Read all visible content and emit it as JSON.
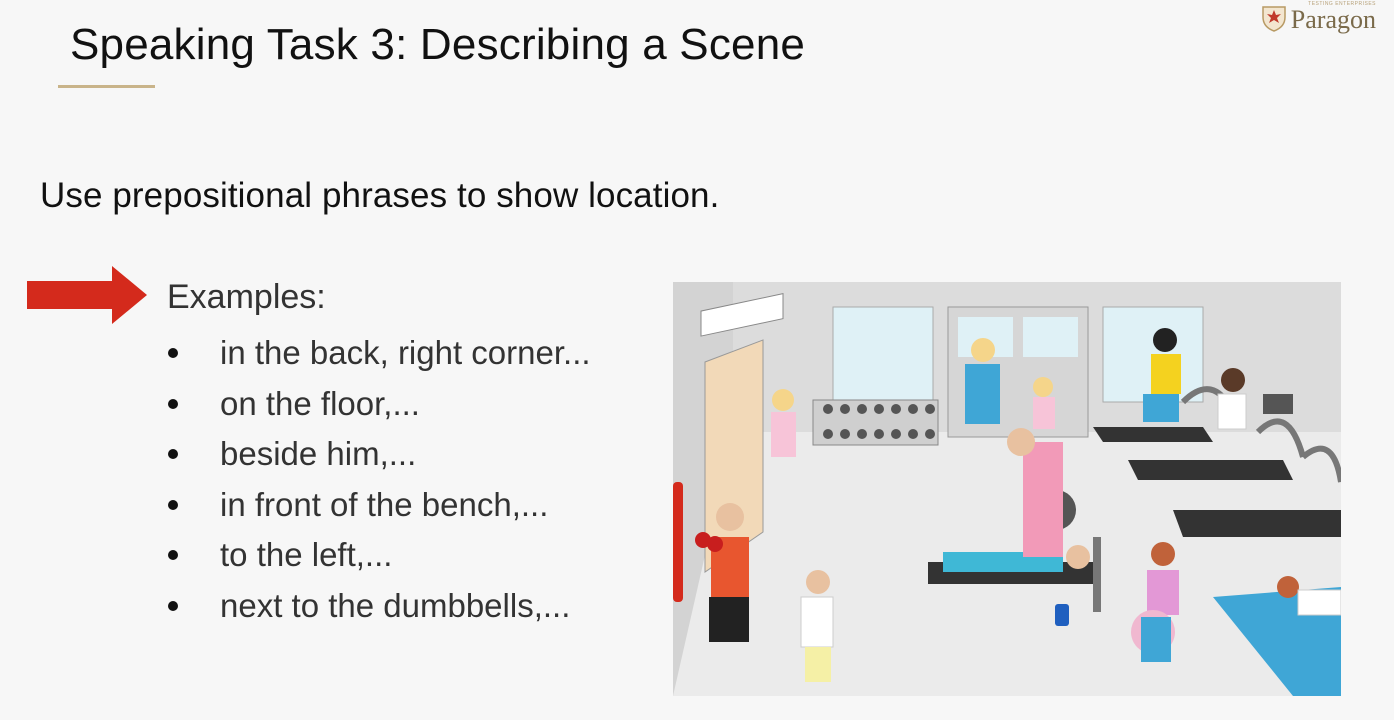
{
  "logo": {
    "text": "Paragon",
    "tagline": "TESTING ENTERPRISES"
  },
  "title": "Speaking Task 3: Describing a Scene",
  "subtitle": "Use prepositional phrases to show location.",
  "examples": {
    "label": "Examples:",
    "items": [
      "in the back, right corner...",
      "on the floor,...",
      "beside him,...",
      "in front of the bench,...",
      "to the left,...",
      "next to the dumbbells,..."
    ]
  },
  "colors": {
    "arrow": "#d42a1c",
    "underline": "#c9b48a",
    "logo_crest": "#c0392b"
  },
  "scene": {
    "subject": "gym scene illustration with people exercising"
  }
}
